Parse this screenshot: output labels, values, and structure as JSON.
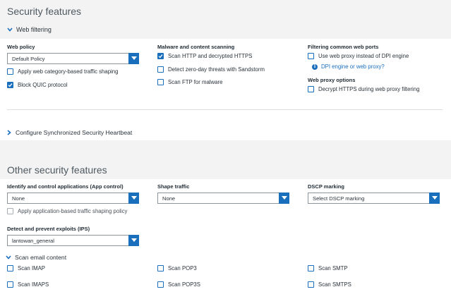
{
  "security_features": {
    "title": "Security features",
    "web_filtering": {
      "header": "Web filtering",
      "web_policy": {
        "label": "Web policy",
        "selected": "Default Policy",
        "options": [
          {
            "label": "Apply web category-based traffic shaping",
            "checked": false
          },
          {
            "label": "Block QUIC protocol",
            "checked": true
          }
        ]
      },
      "malware": {
        "label": "Malware and content scanning",
        "options": [
          {
            "label": "Scan HTTP and decrypted HTTPS",
            "checked": true
          },
          {
            "label": "Detect zero-day threats with Sandstorm",
            "checked": false
          },
          {
            "label": "Scan FTP for malware",
            "checked": false
          }
        ]
      },
      "filtering_ports": {
        "label": "Filtering common web ports",
        "option": {
          "label": "Use web proxy instead of DPI engine",
          "checked": false
        },
        "info_link": "DPI engine or web proxy?"
      },
      "proxy_options": {
        "label": "Web proxy options",
        "option": {
          "label": "Decrypt HTTPS during web proxy filtering",
          "checked": false
        }
      }
    }
  },
  "heartbeat": {
    "label": "Configure Synchronized Security Heartbeat"
  },
  "other": {
    "title": "Other security features",
    "app_control": {
      "label": "Identify and control applications (App control)",
      "selected": "None",
      "option": {
        "label": "Apply application-based traffic shaping policy",
        "checked": false
      }
    },
    "shape_traffic": {
      "label": "Shape traffic",
      "selected": "None"
    },
    "dscp": {
      "label": "DSCP marking",
      "placeholder": "Select DSCP marking"
    },
    "ips": {
      "label": "Detect and prevent exploits (IPS)",
      "selected": "lantowan_general"
    },
    "scan_email": {
      "header": "Scan email content",
      "options": [
        {
          "label": "Scan IMAP",
          "checked": false
        },
        {
          "label": "Scan POP3",
          "checked": false
        },
        {
          "label": "Scan SMTP",
          "checked": false
        },
        {
          "label": "Scan IMAPS",
          "checked": false
        },
        {
          "label": "Scan POP3S",
          "checked": false
        },
        {
          "label": "Scan SMTPS",
          "checked": false
        }
      ]
    }
  },
  "colors": {
    "accent": "#1a6fbd",
    "page_bg": "#f3f3f3",
    "panel_bg": "#ffffff"
  },
  "icons": {
    "expand": "chevron-down-icon",
    "collapsed": "chevron-right-icon",
    "dropdown": "caret-down-icon",
    "info": "info-icon",
    "check": "check-icon"
  }
}
